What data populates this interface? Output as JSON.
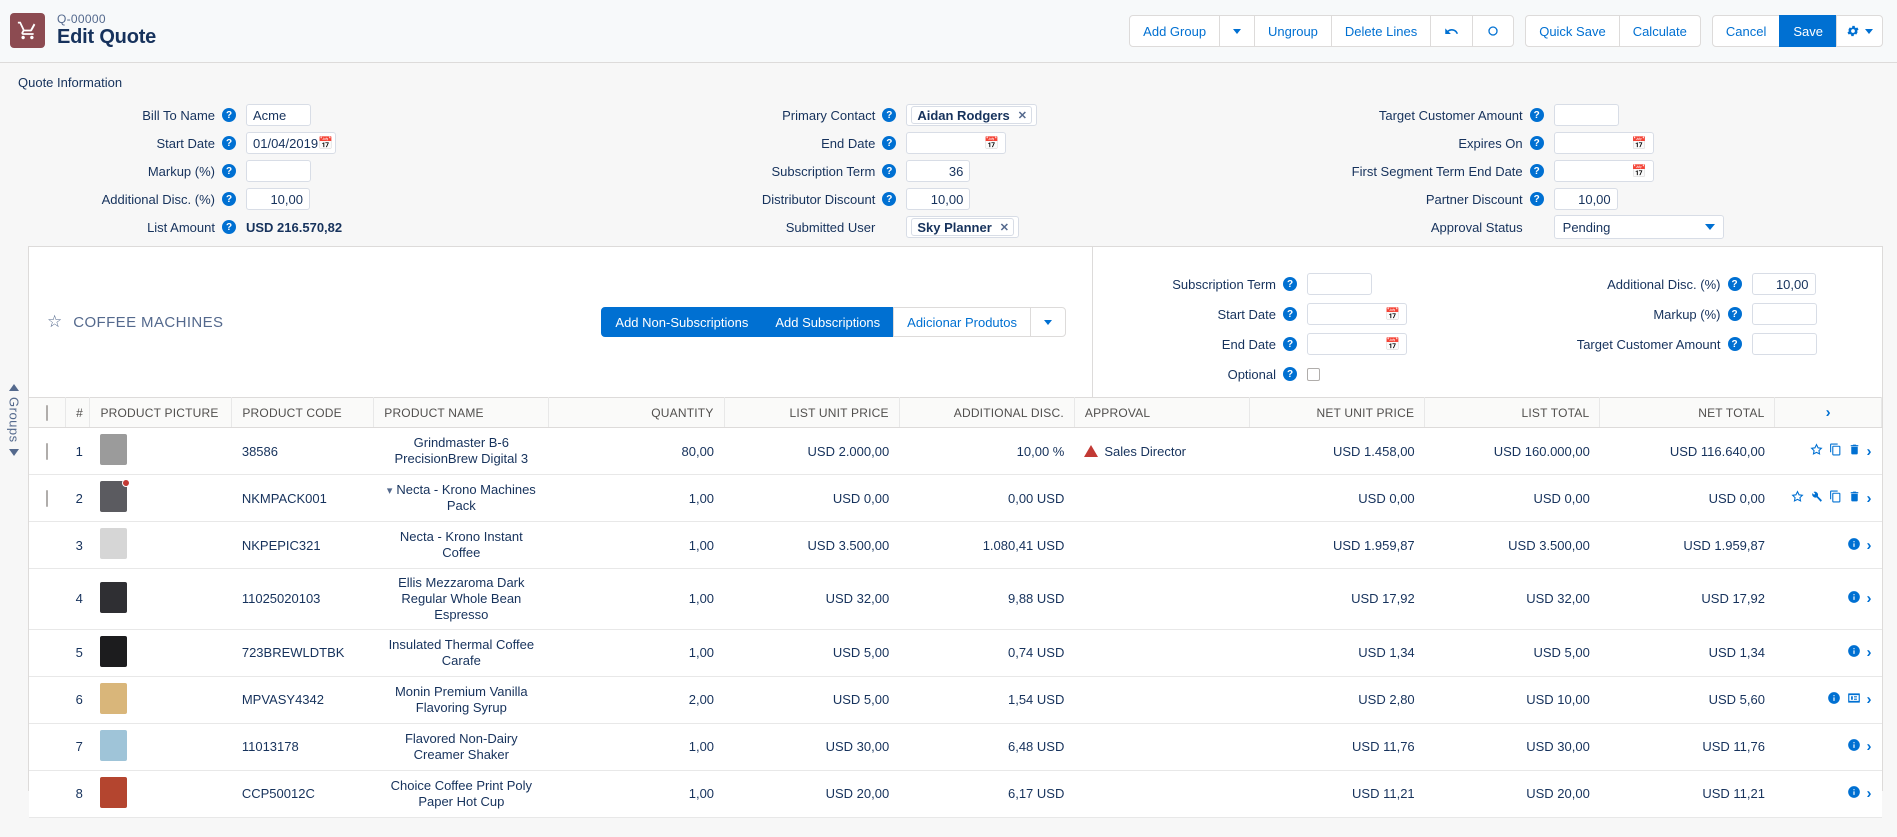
{
  "header": {
    "record_number": "Q-00000",
    "title": "Edit Quote",
    "cart_icon": "shopping-cart-icon",
    "brand_color": "#8c4b51",
    "accent_color": "#0070d2",
    "buttons": {
      "add_group": "Add Group",
      "add_group_dropdown": "caret-down-icon",
      "ungroup": "Ungroup",
      "delete_lines": "Delete Lines",
      "undo": "undo-icon",
      "refresh": "refresh-icon",
      "quick_save": "Quick Save",
      "calculate": "Calculate",
      "cancel": "Cancel",
      "save": "Save",
      "settings": "gear-icon"
    }
  },
  "quote_information": {
    "section_title": "Quote Information",
    "col1": [
      {
        "label": "Bill To Name",
        "value": "Acme",
        "type": "text",
        "help": true
      },
      {
        "label": "Start Date",
        "value": "01/04/2019",
        "type": "date",
        "help": true
      },
      {
        "label": "Markup (%)",
        "value": "",
        "type": "number",
        "help": true
      },
      {
        "label": "Additional Disc. (%)",
        "value": "10,00",
        "type": "number",
        "help": true
      },
      {
        "label": "List Amount",
        "value": "USD 216.570,82",
        "type": "static",
        "help": true
      }
    ],
    "col2": [
      {
        "label": "Primary Contact",
        "value": "Aidan Rodgers",
        "type": "pill",
        "help": true
      },
      {
        "label": "End Date",
        "value": "",
        "type": "date",
        "help": true
      },
      {
        "label": "Subscription Term",
        "value": "36",
        "type": "number",
        "help": true
      },
      {
        "label": "Distributor Discount",
        "value": "10,00",
        "type": "number",
        "help": true
      },
      {
        "label": "Submitted User",
        "value": "Sky Planner",
        "type": "pill",
        "help": false
      }
    ],
    "col3": [
      {
        "label": "Target Customer Amount",
        "value": "",
        "type": "number",
        "help": true
      },
      {
        "label": "Expires On",
        "value": "",
        "type": "date",
        "help": true
      },
      {
        "label": "First Segment Term End Date",
        "value": "",
        "type": "date",
        "help": true
      },
      {
        "label": "Partner Discount",
        "value": "10,00",
        "type": "number",
        "help": true
      },
      {
        "label": "Approval Status",
        "value": "Pending",
        "type": "select",
        "help": false
      }
    ]
  },
  "groups_rail_label": "Groups",
  "group": {
    "name": "COFFEE MACHINES",
    "favorite_icon": "star-outline-icon",
    "actions": {
      "add_non_subscriptions": "Add Non-Subscriptions",
      "add_subscriptions": "Add Subscriptions",
      "adicionar_produtos": "Adicionar Produtos",
      "more_dropdown": "caret-down-icon"
    },
    "fields_left": [
      {
        "label": "Subscription Term",
        "value": "",
        "type": "number",
        "help": true
      },
      {
        "label": "Start Date",
        "value": "",
        "type": "date",
        "help": true
      },
      {
        "label": "End Date",
        "value": "",
        "type": "date",
        "help": true
      },
      {
        "label": "Optional",
        "value": "",
        "type": "checkbox",
        "help": true
      }
    ],
    "fields_right": [
      {
        "label": "Additional Disc. (%)",
        "value": "10,00",
        "type": "number",
        "help": true
      },
      {
        "label": "Markup (%)",
        "value": "",
        "type": "number",
        "help": true
      },
      {
        "label": "Target Customer Amount",
        "value": "",
        "type": "number",
        "help": true
      }
    ]
  },
  "lines_table": {
    "columns": [
      "",
      "#",
      "PRODUCT PICTURE",
      "PRODUCT CODE",
      "PRODUCT NAME",
      "QUANTITY",
      "LIST UNIT PRICE",
      "ADDITIONAL DISC.",
      "APPROVAL",
      "NET UNIT PRICE",
      "LIST TOTAL",
      "NET TOTAL",
      ""
    ],
    "select_all_checkbox": "select-all-checkbox",
    "rows": [
      {
        "num": "1",
        "code": "38586",
        "name": "Grindmaster B-6 PrecisionBrew Digital 3",
        "quantity": "80,00",
        "list_unit_price": "USD 2.000,00",
        "additional_disc": "10,00 %",
        "approval": "Sales Director",
        "approval_warning": true,
        "net_unit_price": "USD 1.458,00",
        "list_total": "USD 160.000,00",
        "net_total": "USD 116.640,00",
        "has_checkbox": true,
        "thumb_color": "#9b9b9b",
        "thumb_badge": false,
        "icons": [
          "star-outline-icon",
          "copy-icon",
          "delete-icon"
        ],
        "expandable": false
      },
      {
        "num": "2",
        "code": "NKMPACK001",
        "name": "Necta - Krono Machines Pack",
        "quantity": "1,00",
        "list_unit_price": "USD 0,00",
        "additional_disc": "0,00 USD",
        "approval": "",
        "approval_warning": false,
        "net_unit_price": "USD 0,00",
        "list_total": "USD 0,00",
        "net_total": "USD 0,00",
        "has_checkbox": true,
        "thumb_color": "#5b5b60",
        "thumb_badge": true,
        "icons": [
          "star-outline-icon",
          "wrench-icon",
          "copy-icon",
          "delete-icon"
        ],
        "expandable": true
      },
      {
        "num": "3",
        "code": "NKPEPIC321",
        "name": "Necta - Krono Instant Coffee",
        "quantity": "1,00",
        "list_unit_price": "USD 3.500,00",
        "additional_disc": "1.080,41 USD",
        "approval": "",
        "approval_warning": false,
        "net_unit_price": "USD 1.959,87",
        "list_total": "USD 3.500,00",
        "net_total": "USD 1.959,87",
        "has_checkbox": false,
        "thumb_color": "#d6d6d6",
        "thumb_badge": false,
        "icons": [
          "info-icon"
        ],
        "expandable": false
      },
      {
        "num": "4",
        "code": "11025020103",
        "name": "Ellis Mezzaroma Dark Regular Whole Bean Espresso",
        "quantity": "1,00",
        "list_unit_price": "USD 32,00",
        "additional_disc": "9,88 USD",
        "approval": "",
        "approval_warning": false,
        "net_unit_price": "USD 17,92",
        "list_total": "USD 32,00",
        "net_total": "USD 17,92",
        "has_checkbox": false,
        "thumb_color": "#2f2f33",
        "thumb_badge": false,
        "icons": [
          "info-icon"
        ],
        "expandable": false
      },
      {
        "num": "5",
        "code": "723BREWLDTBK",
        "name": "Insulated Thermal Coffee Carafe",
        "quantity": "1,00",
        "list_unit_price": "USD 5,00",
        "additional_disc": "0,74 USD",
        "approval": "",
        "approval_warning": false,
        "net_unit_price": "USD 1,34",
        "list_total": "USD 5,00",
        "net_total": "USD 1,34",
        "has_checkbox": false,
        "thumb_color": "#1c1c1e",
        "thumb_badge": false,
        "icons": [
          "info-icon"
        ],
        "expandable": false
      },
      {
        "num": "6",
        "code": "MPVASY4342",
        "name": "Monin Premium Vanilla Flavoring Syrup",
        "quantity": "2,00",
        "list_unit_price": "USD 5,00",
        "additional_disc": "1,54 USD",
        "approval": "",
        "approval_warning": false,
        "net_unit_price": "USD 2,80",
        "list_total": "USD 10,00",
        "net_total": "USD 5,60",
        "has_checkbox": false,
        "thumb_color": "#d9b67a",
        "thumb_badge": false,
        "icons": [
          "info-icon",
          "image-icon"
        ],
        "expandable": false
      },
      {
        "num": "7",
        "code": "11013178",
        "name": "Flavored Non-Dairy Creamer Shaker",
        "quantity": "1,00",
        "list_unit_price": "USD 30,00",
        "additional_disc": "6,48 USD",
        "approval": "",
        "approval_warning": false,
        "net_unit_price": "USD 11,76",
        "list_total": "USD 30,00",
        "net_total": "USD 11,76",
        "has_checkbox": false,
        "thumb_color": "#9fc4d8",
        "thumb_badge": false,
        "icons": [
          "info-icon"
        ],
        "expandable": false
      },
      {
        "num": "8",
        "code": "CCP50012C",
        "name": "Choice Coffee Print Poly Paper Hot Cup",
        "quantity": "1,00",
        "list_unit_price": "USD 20,00",
        "additional_disc": "6,17 USD",
        "approval": "",
        "approval_warning": false,
        "net_unit_price": "USD 11,21",
        "list_total": "USD 20,00",
        "net_total": "USD 11,21",
        "has_checkbox": false,
        "thumb_color": "#b4452f",
        "thumb_badge": false,
        "icons": [
          "info-icon"
        ],
        "expandable": false
      }
    ]
  }
}
